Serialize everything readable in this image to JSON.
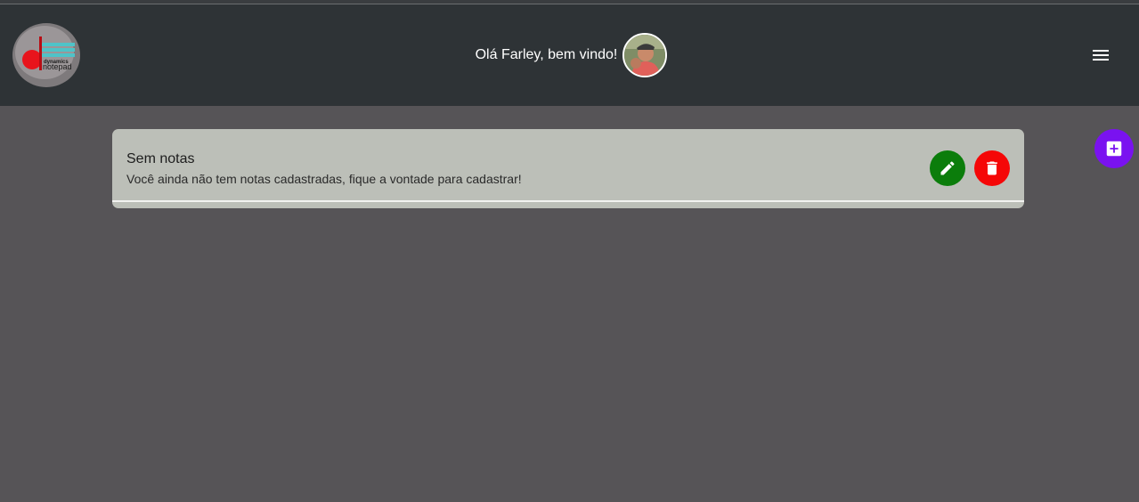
{
  "header": {
    "logo_text_top": "dynamics",
    "logo_text_bottom": "notepad",
    "greeting": "Olá Farley, bem vindo!"
  },
  "note": {
    "title": "Sem notas",
    "description": "Você ainda não tem notas cadastradas, fique a vontade para cadastrar!"
  },
  "colors": {
    "header_bg": "#2e3336",
    "page_bg": "#565457",
    "card_bg": "#bcbfb8",
    "edit_button": "#0b7d0b",
    "delete_button": "#f50707",
    "add_button": "#7a12f0"
  },
  "icons": {
    "menu": "menu-icon",
    "edit": "pencil-icon",
    "delete": "trash-icon",
    "add": "add-box-icon"
  }
}
